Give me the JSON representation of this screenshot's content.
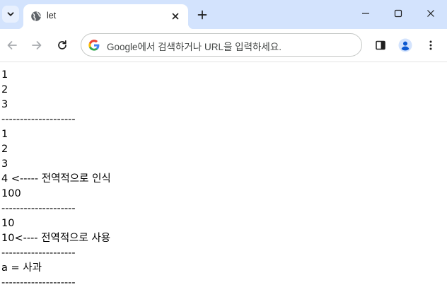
{
  "browser": {
    "tab": {
      "title": "let"
    },
    "omnibox": {
      "placeholder": "Google에서 검색하거나 URL을 입력하세요."
    }
  },
  "page": {
    "lines": [
      "1",
      "2",
      "3",
      "--------------------",
      "1",
      "2",
      "3",
      "4 <----- 전역적으로 인식",
      "100",
      "--------------------",
      "10",
      "10<---- 전역적으로 사용",
      "--------------------",
      "a = 사과",
      "--------------------"
    ]
  },
  "colors": {
    "tabstrip": "#d3e3fd",
    "page_background": "#ffffff",
    "text": "#000000",
    "profile_accent": "#0b57d0"
  }
}
